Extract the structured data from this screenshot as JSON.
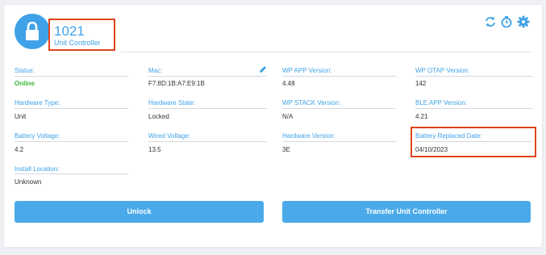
{
  "header": {
    "unit_id": "1021",
    "unit_type": "Unit Controller",
    "icons": [
      "lock-icon",
      "sync-icon",
      "timer-icon",
      "gear-icon",
      "edit-icon"
    ]
  },
  "fields": {
    "status": {
      "label": "Status:",
      "value": "Online"
    },
    "mac": {
      "label": "Mac:",
      "value": "F7:8D:1B:A7:E9:1B"
    },
    "wp_app_version": {
      "label": "WP APP Version:",
      "value": "4.48"
    },
    "wp_otap_version": {
      "label": "WP OTAP Version:",
      "value": "142"
    },
    "hardware_type": {
      "label": "Hardware Type:",
      "value": "Unit"
    },
    "hardware_state": {
      "label": "Hardware State:",
      "value": "Locked"
    },
    "wp_stack_version": {
      "label": "WP STACK Version:",
      "value": "N/A"
    },
    "ble_app_version": {
      "label": "BLE APP Version:",
      "value": "4.21"
    },
    "battery_voltage": {
      "label": "Battery Voltage:",
      "value": "4.2"
    },
    "wired_voltage": {
      "label": "Wired Voltage:",
      "value": "13.5"
    },
    "hardware_version": {
      "label": "Hardware Version:",
      "value": "3E"
    },
    "battery_replaced_date": {
      "label": "Battery Replaced Date:",
      "value": "04/10/2023"
    },
    "install_location": {
      "label": "Install Location:",
      "value": "Unknown"
    }
  },
  "actions": {
    "unlock_label": "Unlock",
    "transfer_label": "Transfer Unit Controller"
  },
  "colors": {
    "accent": "#3fa2e8",
    "button": "#4aaae9",
    "online": "#3cb73c",
    "annotation": "#e0441c"
  }
}
